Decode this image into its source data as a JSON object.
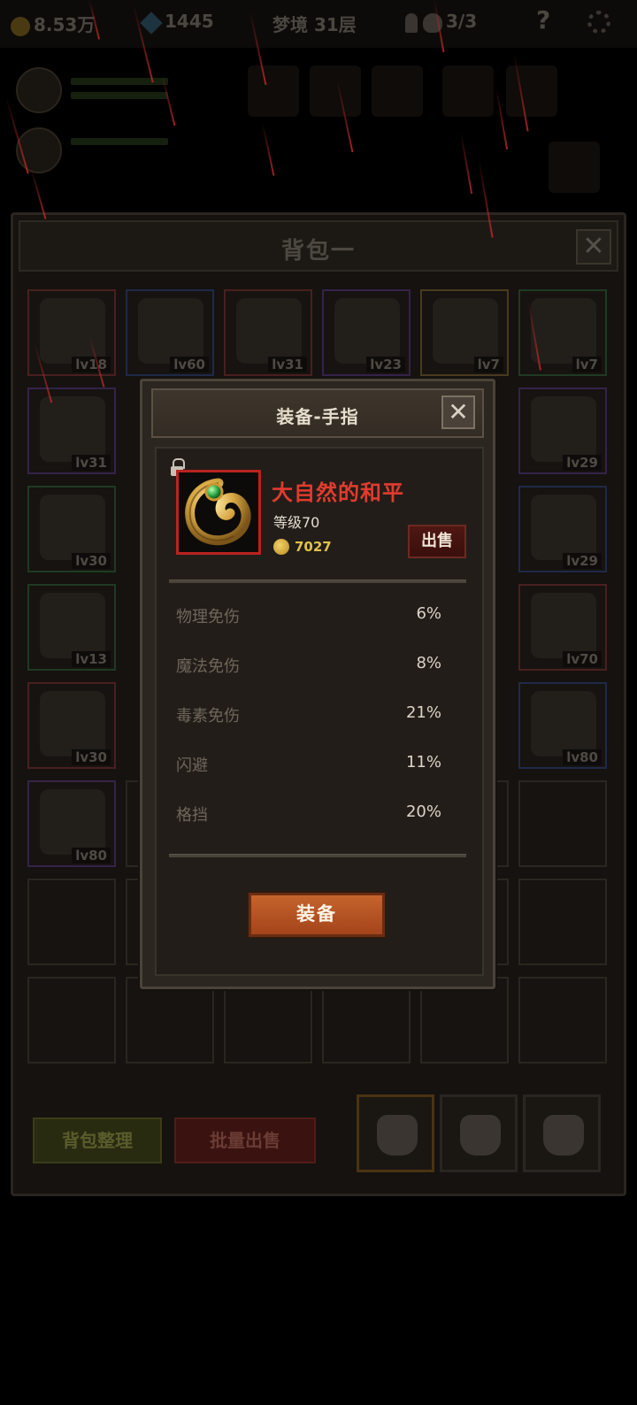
{
  "hud": {
    "gold": "8.53万",
    "gems": "1445",
    "floor": "梦境 31层",
    "keys_skulls": "3/3"
  },
  "inventory": {
    "title": "背包一",
    "close_label": "✕",
    "sort_button": "背包整理",
    "bulk_sell_button": "批量出售",
    "slots": [
      {
        "level": "lv18",
        "rarity": "red"
      },
      {
        "level": "lv60",
        "rarity": "blue"
      },
      {
        "level": "lv31",
        "rarity": "red"
      },
      {
        "level": "lv23",
        "rarity": "purple"
      },
      {
        "level": "lv7",
        "rarity": "orange"
      },
      {
        "level": "lv7",
        "rarity": "green"
      },
      {
        "level": "lv31",
        "rarity": "purple"
      },
      {
        "level": "lv29",
        "rarity": "purple"
      },
      {
        "level": "lv30",
        "rarity": "green"
      },
      {
        "level": "lv29",
        "rarity": "blue"
      },
      {
        "level": "lv13",
        "rarity": "green"
      },
      {
        "level": "lv70",
        "rarity": "red"
      },
      {
        "level": "lv30",
        "rarity": "red"
      },
      {
        "level": "lv80",
        "rarity": "blue"
      },
      {
        "level": "lv80",
        "rarity": "purple"
      }
    ]
  },
  "modal": {
    "title": "装备-手指",
    "close_label": "✕",
    "item_name": "大自然的和平",
    "item_level": "等级70",
    "price": "7027",
    "sell_button": "出售",
    "stats": [
      {
        "label": "物理免伤",
        "value": "6%"
      },
      {
        "label": "魔法免伤",
        "value": "8%"
      },
      {
        "label": "毒素免伤",
        "value": "21%"
      },
      {
        "label": "闪避",
        "value": "11%"
      },
      {
        "label": "格挡",
        "value": "20%"
      }
    ],
    "equip_button": "装备"
  },
  "colors": {
    "item_name": "#e23b2e",
    "equip_button": "#b85526",
    "price": "#e0c24b"
  }
}
